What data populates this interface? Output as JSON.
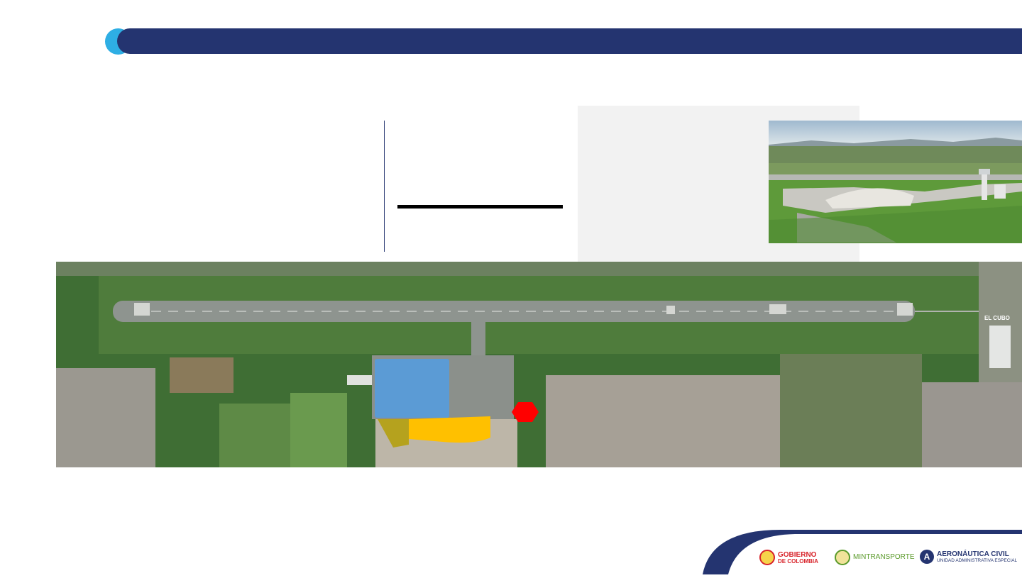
{
  "header": {
    "bar_color": "#243470",
    "dot_color": "#2eaee4"
  },
  "aerial_map": {
    "place_label": "EL CUBO",
    "markers": [
      {
        "name": "blue-zone",
        "color": "#5b9bd5"
      },
      {
        "name": "yellow-zone",
        "color": "#ffc000"
      },
      {
        "name": "red-zone",
        "color": "#ff0000"
      }
    ]
  },
  "footer": {
    "logos": [
      {
        "name": "gobierno-de-colombia",
        "line1": "GOBIERNO",
        "line2": "DE COLOMBIA",
        "color": "#d8232a"
      },
      {
        "name": "mintransporte",
        "line1": "MINTRANSPORTE",
        "line2": "",
        "color": "#5a9a2a"
      },
      {
        "name": "aeronautica-civil",
        "line1": "AERONÁUTICA CIVIL",
        "line2": "UNIDAD ADMINISTRATIVA ESPECIAL",
        "color": "#243470"
      }
    ]
  }
}
